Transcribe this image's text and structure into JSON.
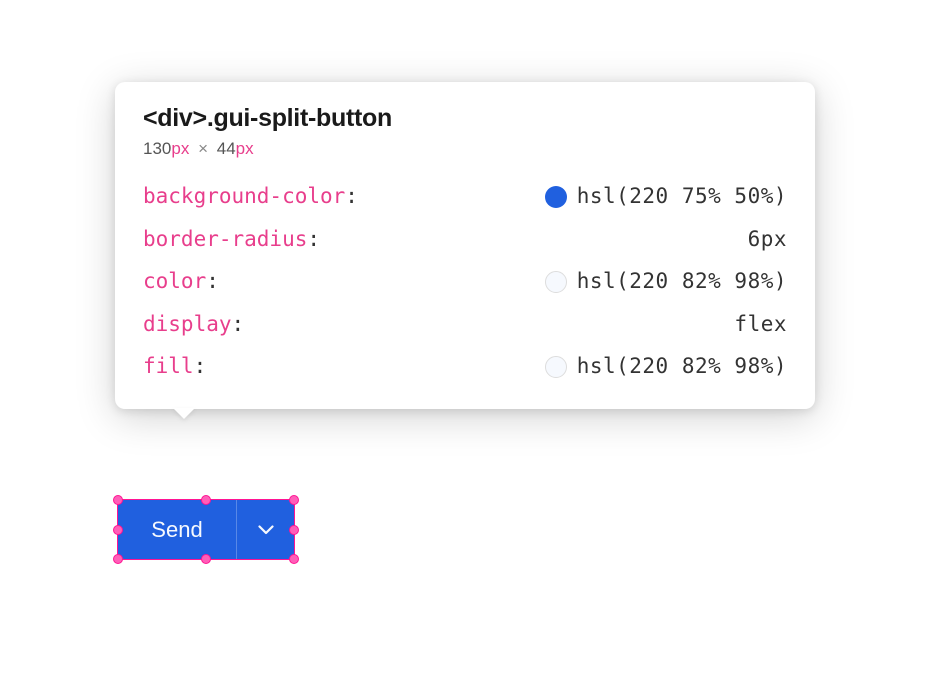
{
  "tooltip": {
    "element_tag": "<div>",
    "element_class": ".gui-split-button",
    "width_num": "130",
    "width_unit": "px",
    "times": "×",
    "height_num": "44",
    "height_unit": "px",
    "props": [
      {
        "name": "background-color",
        "value": "hsl(220 75% 50%)",
        "swatch": "blue"
      },
      {
        "name": "border-radius",
        "value": "6px",
        "swatch": null
      },
      {
        "name": "color",
        "value": "hsl(220 82% 98%)",
        "swatch": "light"
      },
      {
        "name": "display",
        "value": "flex",
        "swatch": null
      },
      {
        "name": "fill",
        "value": "hsl(220 82% 98%)",
        "swatch": "light"
      }
    ]
  },
  "splitButton": {
    "label": "Send"
  },
  "colors": {
    "accent": "#ff1493",
    "button_bg": "hsl(220, 75%, 50%)",
    "button_fg": "hsl(220, 82%, 98%)"
  }
}
